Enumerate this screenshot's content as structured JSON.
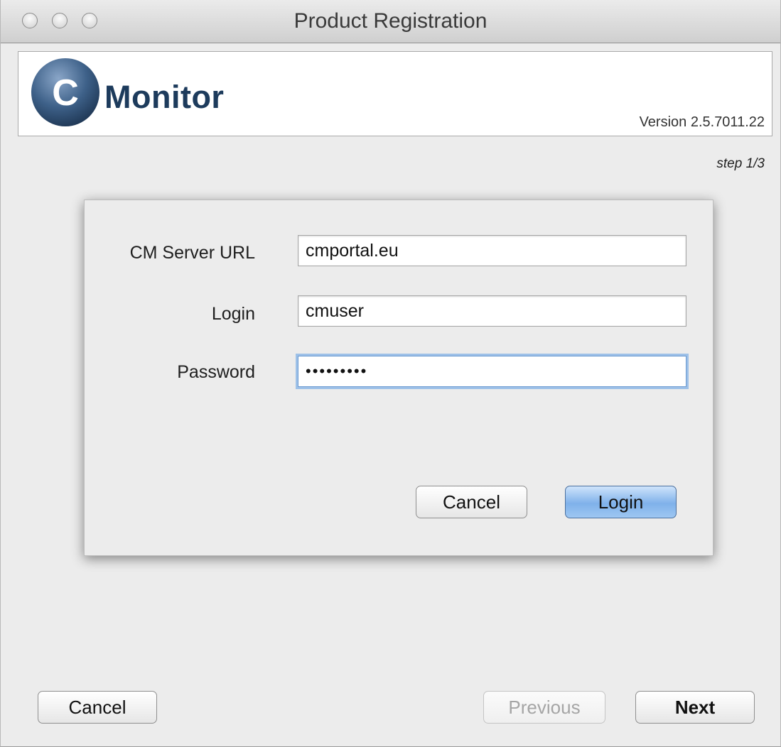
{
  "window": {
    "title": "Product Registration"
  },
  "header": {
    "logo_letter": "C",
    "logo_text": "Monitor",
    "version": "Version 2.5.7011.22"
  },
  "step": "step 1/3",
  "login_dialog": {
    "server_label": "CM Server URL",
    "server_value": "cmportal.eu",
    "login_label": "Login",
    "login_value": "cmuser",
    "password_label": "Password",
    "password_value": "•••••••••",
    "cancel_label": "Cancel",
    "login_button_label": "Login"
  },
  "footer": {
    "cancel_label": "Cancel",
    "previous_label": "Previous",
    "next_label": "Next"
  },
  "colors": {
    "logo_blue": "#1d3b5c",
    "accent_blue": "#7fb1ea",
    "focus_ring": "#9ec1e8"
  }
}
